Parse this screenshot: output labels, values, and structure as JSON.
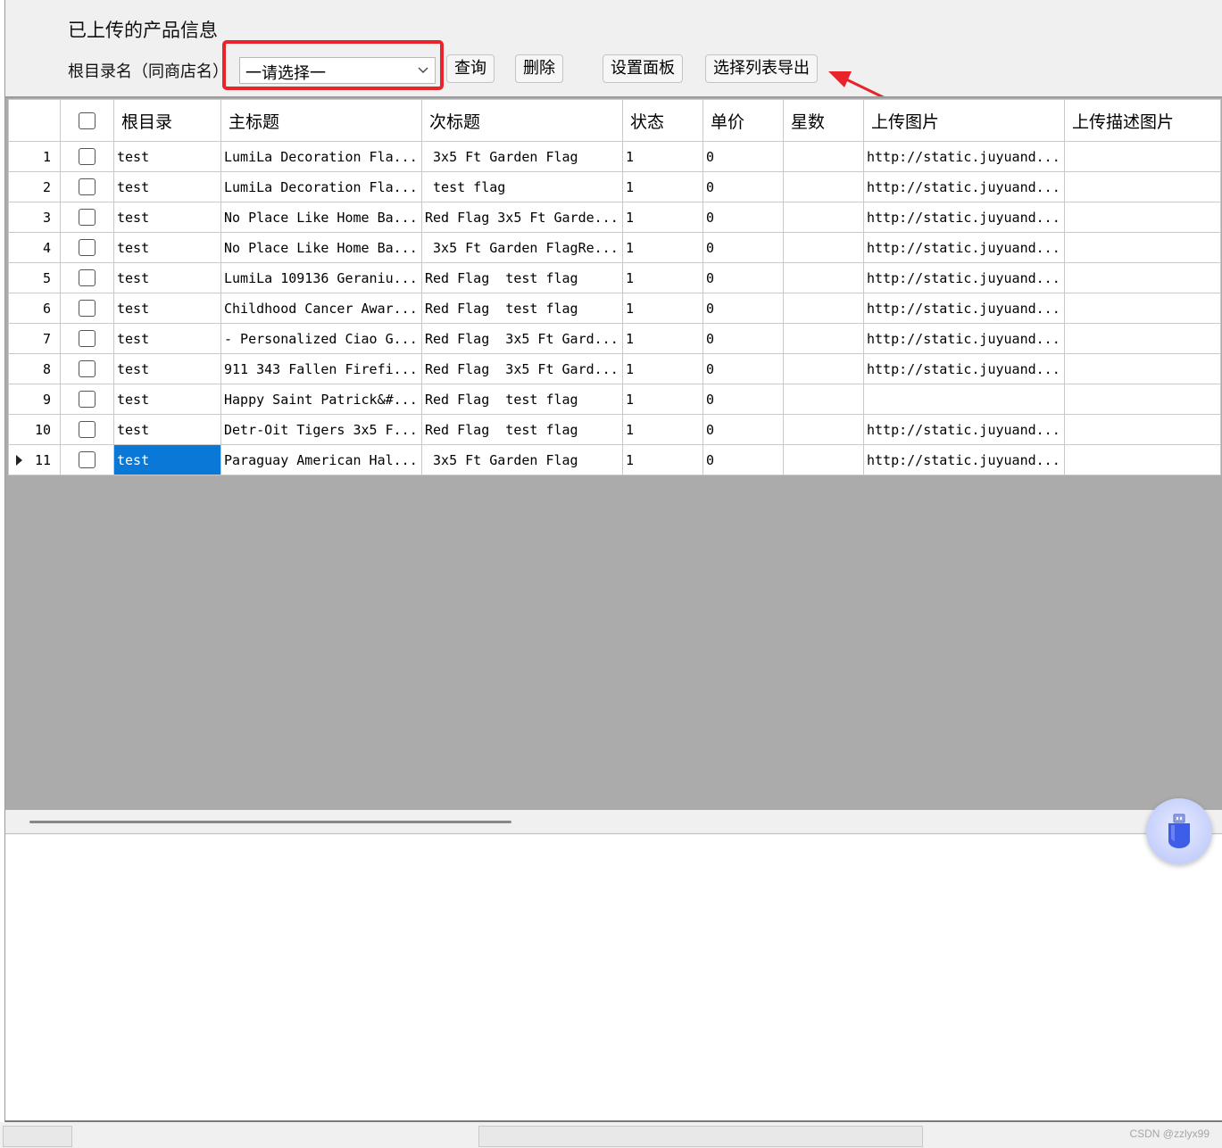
{
  "panel_title": "已上传的产品信息",
  "filter": {
    "label": "根目录名（同商店名）",
    "select_value": "一请选择一"
  },
  "buttons": {
    "query": "查询",
    "delete": "删除",
    "settings": "设置面板",
    "export": "选择列表导出"
  },
  "table": {
    "columns": [
      "根目录",
      "主标题",
      "次标题",
      "状态",
      "单价",
      "星数",
      "上传图片",
      "上传描述图片"
    ],
    "rows": [
      {
        "num": "1",
        "root": "test",
        "title": "LumiLa Decoration Fla...",
        "subtitle": " 3x5 Ft Garden Flag",
        "status": "1",
        "price": "0",
        "stars": "",
        "image": "http://static.juyuand...",
        "desc_image": ""
      },
      {
        "num": "2",
        "root": "test",
        "title": "LumiLa Decoration Fla...",
        "subtitle": " test flag",
        "status": "1",
        "price": "0",
        "stars": "",
        "image": "http://static.juyuand...",
        "desc_image": ""
      },
      {
        "num": "3",
        "root": "test",
        "title": "No Place Like Home Ba...",
        "subtitle": "Red Flag 3x5 Ft Garde...",
        "status": "1",
        "price": "0",
        "stars": "",
        "image": "http://static.juyuand...",
        "desc_image": ""
      },
      {
        "num": "4",
        "root": "test",
        "title": "No Place Like Home Ba...",
        "subtitle": " 3x5 Ft Garden FlagRe...",
        "status": "1",
        "price": "0",
        "stars": "",
        "image": "http://static.juyuand...",
        "desc_image": ""
      },
      {
        "num": "5",
        "root": "test",
        "title": "LumiLa 109136 Geraniu...",
        "subtitle": "Red Flag  test flag",
        "status": "1",
        "price": "0",
        "stars": "",
        "image": "http://static.juyuand...",
        "desc_image": ""
      },
      {
        "num": "6",
        "root": "test",
        "title": "Childhood Cancer Awar...",
        "subtitle": "Red Flag  test flag",
        "status": "1",
        "price": "0",
        "stars": "",
        "image": "http://static.juyuand...",
        "desc_image": ""
      },
      {
        "num": "7",
        "root": "test",
        "title": "- Personalized Ciao G...",
        "subtitle": "Red Flag  3x5 Ft Gard...",
        "status": "1",
        "price": "0",
        "stars": "",
        "image": "http://static.juyuand...",
        "desc_image": ""
      },
      {
        "num": "8",
        "root": "test",
        "title": "911 343 Fallen Firefi...",
        "subtitle": "Red Flag  3x5 Ft Gard...",
        "status": "1",
        "price": "0",
        "stars": "",
        "image": "http://static.juyuand...",
        "desc_image": ""
      },
      {
        "num": "9",
        "root": "test",
        "title": "Happy Saint Patrick&#...",
        "subtitle": "Red Flag  test flag",
        "status": "1",
        "price": "0",
        "stars": "",
        "image": "",
        "desc_image": ""
      },
      {
        "num": "10",
        "root": "test",
        "title": "Detr-Oit Tigers 3x5 F...",
        "subtitle": "Red Flag  test flag",
        "status": "1",
        "price": "0",
        "stars": "",
        "image": "http://static.juyuand...",
        "desc_image": ""
      },
      {
        "num": "11",
        "root": "test",
        "title": "Paraguay American Hal...",
        "subtitle": " 3x5 Ft Garden Flag",
        "status": "1",
        "price": "0",
        "stars": "",
        "image": "http://static.juyuand...",
        "desc_image": ""
      }
    ],
    "selected_row": 11
  },
  "watermark": "CSDN @zzlyx99",
  "colors": {
    "annotation_red": "#e8232a",
    "selection_blue": "#0a78d7",
    "empty_grid_gray": "#ababab"
  },
  "icons": {
    "select_dropdown": "chevron-down-icon",
    "current_row": "row-pointer-icon",
    "floating_widget": "usb-drive-icon",
    "annotation": "red-arrow-icon"
  }
}
